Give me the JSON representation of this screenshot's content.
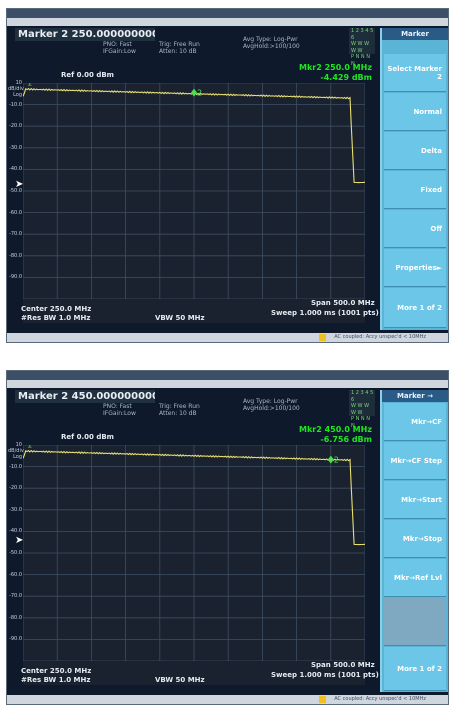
{
  "shots": [
    {
      "marker_title": "Marker 2 250.000000000 MHz",
      "panel_title": "Marker",
      "buttons": [
        {
          "label": "Select Marker 2",
          "gray": false
        },
        {
          "label": "Normal",
          "gray": false
        },
        {
          "label": "Delta",
          "gray": false
        },
        {
          "label": "Fixed",
          "gray": false
        },
        {
          "label": "Off",
          "gray": false
        },
        {
          "label": "Properties►",
          "gray": false
        },
        {
          "label": "More 1 of 2",
          "gray": false
        }
      ],
      "ref_level": "Ref 0.00 dBm",
      "marker_readout_line1": "Mkr2 250.0 MHz",
      "marker_readout_line2": "-4.429 dBm",
      "info": {
        "pno": "PNO: Fast",
        "ifgain": "IFGain:Low",
        "trig": "Trig: Free Run",
        "atten": "Atten: 10 dB",
        "avg_type": "Avg Type: Log-Pwr",
        "avg_hold": "AvgHold:>100/100"
      },
      "center": "Center 250.0 MHz",
      "res_bw": "#Res BW 1.0 MHz",
      "vbw": "VBW 50 MHz",
      "span": "Span 500.0 MHz",
      "sweep": "Sweep  1.000 ms (1001 pts)",
      "status": "AC coupled: Accy unspec'd < 10MHz",
      "marker_pos": {
        "x_mhz": 250.0,
        "y_dbm": -4.429,
        "label": "2"
      },
      "ylabels": [
        "10 dB/div Log",
        "-10.0",
        "-20.0",
        "-30.0",
        "-40.0",
        "-50.0",
        "-60.0",
        "-70.0",
        "-80.0",
        "-90.0"
      ]
    },
    {
      "marker_title": "Marker 2 450.000000000 MHz",
      "panel_title": "Marker →",
      "buttons": [
        {
          "label": "Mkr→CF",
          "gray": false
        },
        {
          "label": "Mkr→CF Step",
          "gray": false
        },
        {
          "label": "Mkr→Start",
          "gray": false
        },
        {
          "label": "Mkr→Stop",
          "gray": false
        },
        {
          "label": "Mkr→Ref Lvl",
          "gray": false
        },
        {
          "label": "",
          "gray": true
        },
        {
          "label": "More 1 of 2",
          "gray": false
        }
      ],
      "ref_level": "Ref 0.00 dBm",
      "marker_readout_line1": "Mkr2 450.0 MHz",
      "marker_readout_line2": "-6.756 dBm",
      "info": {
        "pno": "PNO: Fast",
        "ifgain": "IFGain:Low",
        "trig": "Trig: Free Run",
        "atten": "Atten: 10 dB",
        "avg_type": "Avg Type: Log-Pwr",
        "avg_hold": "AvgHold:>100/100"
      },
      "center": "Center 250.0 MHz",
      "res_bw": "#Res BW 1.0 MHz",
      "vbw": "VBW 50 MHz",
      "span": "Span 500.0 MHz",
      "sweep": "Sweep  1.000 ms (1001 pts)",
      "status": "AC coupled: Accy unspec'd < 10MHz",
      "marker_pos": {
        "x_mhz": 450.0,
        "y_dbm": -6.756,
        "label": "2"
      },
      "ylabels": [
        "10 dB/div Log",
        "-10.0",
        "-20.0",
        "-30.0",
        "-40.0",
        "-50.0",
        "-60.0",
        "-70.0",
        "-80.0",
        "-90.0"
      ]
    }
  ],
  "colors": {
    "trace": "#e8e070",
    "grid": "#3e4e62",
    "marker": "#4fe04f",
    "screen_bg": "#1a2230"
  }
}
